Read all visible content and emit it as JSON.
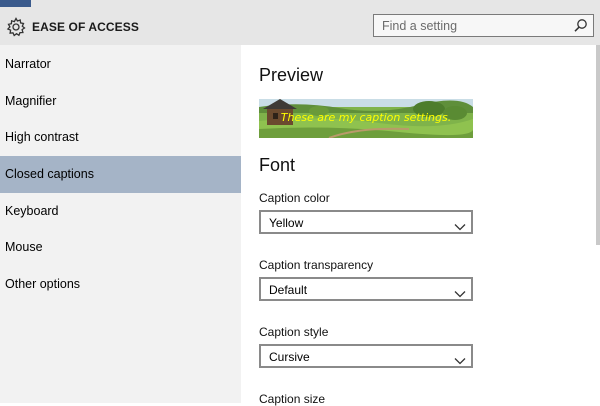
{
  "header": {
    "app_title": "EASE OF ACCESS",
    "search_placeholder": "Find a setting"
  },
  "sidebar": {
    "items": [
      {
        "label": "Narrator",
        "selected": false
      },
      {
        "label": "Magnifier",
        "selected": false
      },
      {
        "label": "High contrast",
        "selected": false
      },
      {
        "label": "Closed captions",
        "selected": true
      },
      {
        "label": "Keyboard",
        "selected": false
      },
      {
        "label": "Mouse",
        "selected": false
      },
      {
        "label": "Other options",
        "selected": false
      }
    ]
  },
  "main": {
    "preview_heading": "Preview",
    "preview_caption": "These are my caption settings.",
    "font_heading": "Font",
    "caption_color": {
      "label": "Caption color",
      "value": "Yellow"
    },
    "caption_transparency": {
      "label": "Caption transparency",
      "value": "Default"
    },
    "caption_style": {
      "label": "Caption style",
      "value": "Cursive"
    },
    "caption_size": {
      "label": "Caption size"
    }
  },
  "colors": {
    "selected_nav": "#a5b4c7",
    "sidebar_bg": "#f2f2f2",
    "header_bg": "#e6e6e6",
    "caption_text": "#ffff00"
  }
}
